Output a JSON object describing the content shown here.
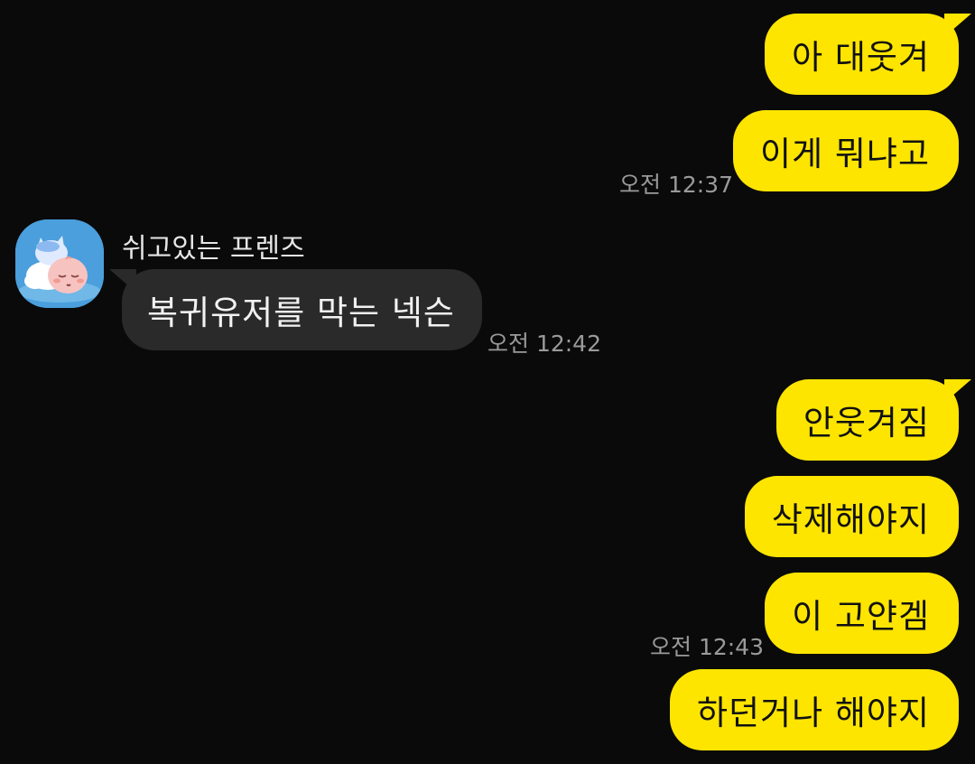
{
  "chat": {
    "messages": [
      {
        "text": "아 대웃겨"
      },
      {
        "text": "이게 뭐냐고"
      },
      {
        "text": "복귀유저를 막는 넥슨"
      },
      {
        "text": "안웃겨짐"
      },
      {
        "text": "삭제해야지"
      },
      {
        "text": "이 고얀겜"
      },
      {
        "text": "하던거나 해야지"
      }
    ],
    "times": {
      "t1": "오전 12:37",
      "t2": "오전 12:42",
      "t3": "오전 12:43"
    },
    "sender": {
      "name": "쉬고있는 프렌즈",
      "avatar_icon": "friends-sleeping-avatar-icon"
    }
  },
  "colors": {
    "background": "#0a0a0a",
    "my_bubble": "#fee500",
    "their_bubble": "#2a2a2a",
    "timestamp": "#9a9a9a"
  }
}
